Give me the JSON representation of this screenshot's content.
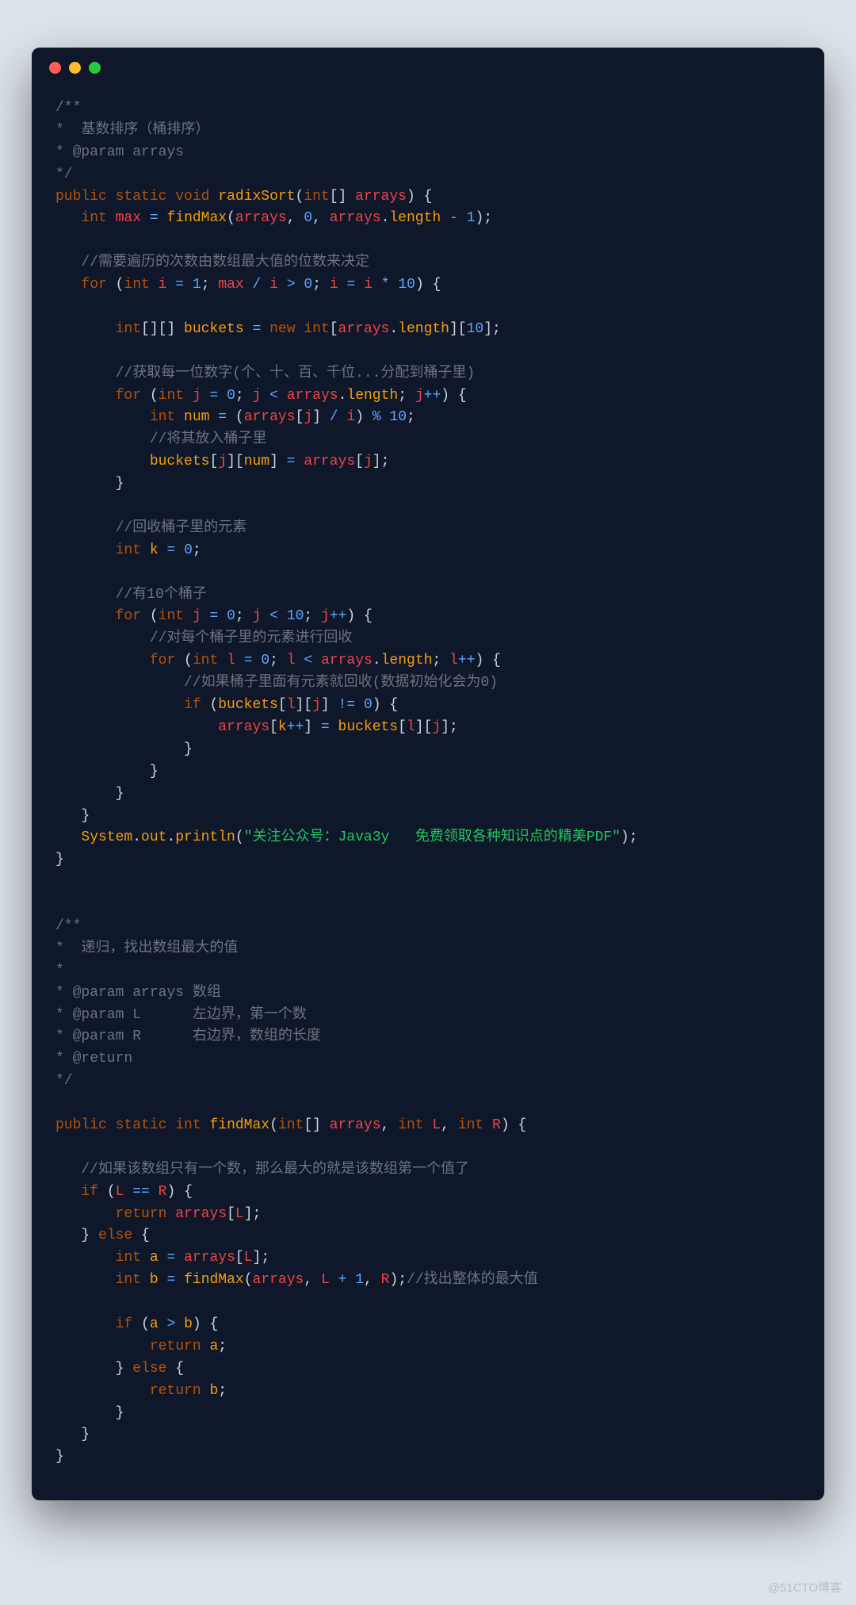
{
  "watermark": "@51CTO博客",
  "code": {
    "radix": {
      "doc1": "/**",
      "doc2": "*  基数排序（桶排序）",
      "doc3": "* @param arrays",
      "doc4": "*/",
      "sig_public": "public",
      "sig_static": "static",
      "sig_void": "void",
      "sig_name": "radixSort",
      "sig_ptype": "int",
      "sig_pname": "arrays",
      "l_max_decl_int": "int",
      "l_max_decl_name": "max",
      "l_max_decl_fn": "findMax",
      "l_max_decl_arg1": "arrays",
      "l_max_decl_arg2": "0",
      "l_max_decl_arg3a": "arrays",
      "l_max_decl_arg3b": "length",
      "l_max_decl_arg3c": "1",
      "cmt_loop": "//需要遍历的次数由数组最大值的位数来决定",
      "for_kw": "for",
      "for_i_int": "int",
      "for_i": "i",
      "for_i_init": "1",
      "for_max": "max",
      "for_gt": "0",
      "for_mul": "10",
      "buckets_decl_int": "int",
      "buckets_name": "buckets",
      "buckets_new": "new",
      "buckets_new_int": "int",
      "buckets_src": "arrays",
      "buckets_len": "length",
      "buckets_ten": "10",
      "cmt_digits": "//获取每一位数字(个、十、百、千位...分配到桶子里)",
      "for_j_int": "int",
      "for_j": "j",
      "for_j_init": "0",
      "for_j_arr": "arrays",
      "for_j_len": "length",
      "num_decl_int": "int",
      "num_name": "num",
      "num_arr": "arrays",
      "num_j": "j",
      "num_i": "i",
      "num_mod": "10",
      "cmt_put": "//将其放入桶子里",
      "put_buckets": "buckets",
      "put_j": "j",
      "put_num": "num",
      "put_arr": "arrays",
      "put_j2": "j",
      "cmt_collect": "//回收桶子里的元素",
      "k_decl_int": "int",
      "k_name": "k",
      "k_init": "0",
      "cmt_tenbuckets": "//有10个桶子",
      "for_j2_int": "int",
      "for_j2": "j",
      "for_j2_init": "0",
      "for_j2_lim": "10",
      "cmt_eachbucket": "//对每个桶子里的元素进行回收",
      "for_l_int": "int",
      "for_l": "l",
      "for_l_init": "0",
      "for_l_arr": "arrays",
      "for_l_len": "length",
      "cmt_ifnz": "//如果桶子里面有元素就回收(数据初始化会为0)",
      "if_kw": "if",
      "if_buckets": "buckets",
      "if_l": "l",
      "if_j": "j",
      "if_zero": "0",
      "assign_arr": "arrays",
      "assign_k": "k",
      "assign_buckets": "buckets",
      "assign_l": "l",
      "assign_j": "j",
      "sys": "System",
      "out": "out",
      "println": "println",
      "msg": "\"关注公众号：Java3y   免费领取各种知识点的精美PDF\""
    },
    "findmax": {
      "doc1": "/**",
      "doc2": "*  递归，找出数组最大的值",
      "doc3": "*",
      "doc4": "* @param arrays 数组",
      "doc5": "* @param L      左边界，第一个数",
      "doc6": "* @param R      右边界，数组的长度",
      "doc7": "* @return",
      "doc8": "*/",
      "sig_public": "public",
      "sig_static": "static",
      "sig_ret": "int",
      "sig_name": "findMax",
      "p1t": "int",
      "p1n": "arrays",
      "p2t": "int",
      "p2n": "L",
      "p3t": "int",
      "p3n": "R",
      "cmt_single": "//如果该数组只有一个数，那么最大的就是该数组第一个值了",
      "if_kw": "if",
      "if_L": "L",
      "if_R": "R",
      "ret_kw": "return",
      "ret_arr": "arrays",
      "ret_L": "L",
      "else_kw": "else",
      "a_int": "int",
      "a_name": "a",
      "a_arr": "arrays",
      "a_L": "L",
      "b_int": "int",
      "b_name": "b",
      "b_fn": "findMax",
      "b_arr": "arrays",
      "b_L": "L",
      "b_one": "1",
      "b_R": "R",
      "b_cmt": "//找出整体的最大值",
      "cmp_if": "if",
      "cmp_a": "a",
      "cmp_b": "b",
      "ret_a_kw": "return",
      "ret_a": "a",
      "cmp_else": "else",
      "ret_b_kw": "return",
      "ret_b": "b"
    }
  }
}
